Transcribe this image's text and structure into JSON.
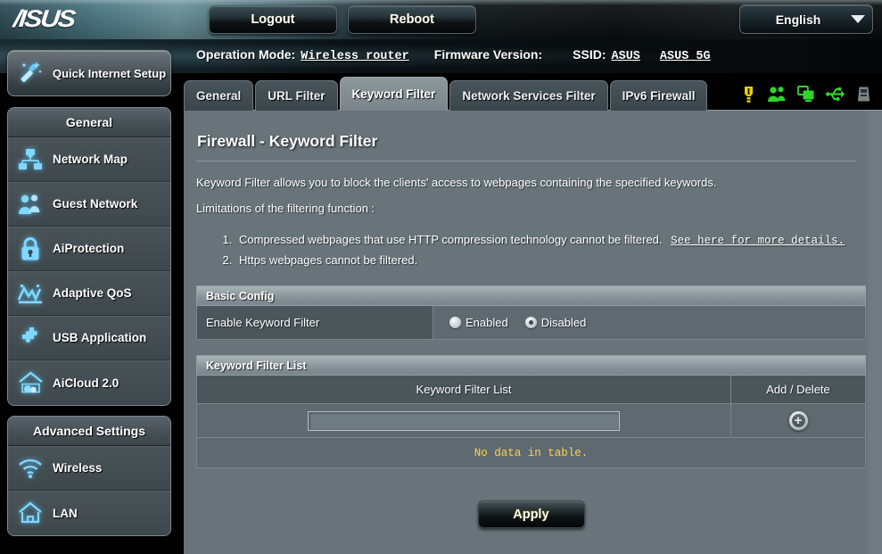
{
  "header": {
    "logo_text": "/ISUS",
    "logout_label": "Logout",
    "reboot_label": "Reboot",
    "language_label": "English"
  },
  "info": {
    "operation_mode_label": "Operation Mode:",
    "operation_mode_value": "Wireless router",
    "firmware_label": "Firmware Version:",
    "firmware_value": "",
    "ssid_label": "SSID:",
    "ssid_1": "ASUS",
    "ssid_2": "ASUS_5G"
  },
  "status_icons": [
    {
      "name": "alert-icon",
      "color": "#e8d000"
    },
    {
      "name": "users-icon",
      "color": "#2fd42f"
    },
    {
      "name": "clients-icon",
      "color": "#2fd42f"
    },
    {
      "name": "usb-icon",
      "color": "#2fd42f"
    },
    {
      "name": "printer-icon",
      "color": "#7c8489"
    }
  ],
  "sidebar": {
    "quick_setup_label": "Quick Internet Setup",
    "general": {
      "title": "General",
      "items": [
        {
          "label": "Network Map",
          "icon": "network-map-icon"
        },
        {
          "label": "Guest Network",
          "icon": "guest-network-icon"
        },
        {
          "label": "AiProtection",
          "icon": "lock-icon"
        },
        {
          "label": "Adaptive QoS",
          "icon": "qos-chart-icon"
        },
        {
          "label": "USB Application",
          "icon": "puzzle-icon"
        },
        {
          "label": "AiCloud 2.0",
          "icon": "cloud-home-icon"
        }
      ]
    },
    "advanced": {
      "title": "Advanced Settings",
      "items": [
        {
          "label": "Wireless",
          "icon": "wifi-icon"
        },
        {
          "label": "LAN",
          "icon": "house-icon"
        }
      ]
    }
  },
  "tabs": [
    {
      "label": "General",
      "active": false
    },
    {
      "label": "URL Filter",
      "active": false
    },
    {
      "label": "Keyword Filter",
      "active": true
    },
    {
      "label": "Network Services Filter",
      "active": false
    },
    {
      "label": "IPv6 Firewall",
      "active": false
    }
  ],
  "main": {
    "title": "Firewall - Keyword Filter",
    "description": "Keyword Filter allows you to block the clients' access to webpages containing the specified keywords.",
    "limitations_label": "Limitations of the filtering function :",
    "limitations": [
      {
        "text": "Compressed webpages that use HTTP compression technology cannot be filtered.",
        "link": "See here for more details."
      },
      {
        "text": "Https webpages cannot be filtered.",
        "link": ""
      }
    ],
    "basic_config": {
      "header": "Basic Config",
      "row_label": "Enable Keyword Filter",
      "options": [
        {
          "label": "Enabled",
          "selected": false
        },
        {
          "label": "Disabled",
          "selected": true
        }
      ]
    },
    "filter_list": {
      "header": "Keyword Filter List",
      "col_keyword": "Keyword Filter List",
      "col_action": "Add / Delete",
      "input_value": "",
      "input_placeholder": "",
      "add_icon": "plus-circle-icon",
      "empty_text": "No data in table."
    },
    "apply_label": "Apply"
  }
}
